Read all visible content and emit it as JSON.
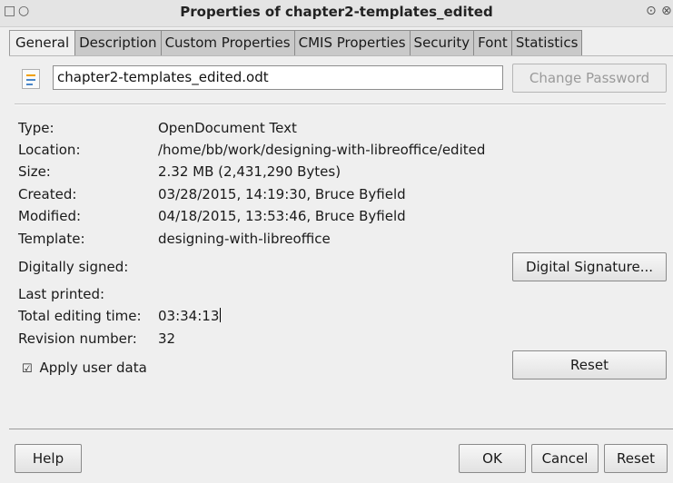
{
  "window": {
    "title": "Properties of chapter2-templates_edited"
  },
  "tabs": [
    {
      "label": "General",
      "active": true
    },
    {
      "label": "Description"
    },
    {
      "label": "Custom Properties"
    },
    {
      "label": "CMIS Properties"
    },
    {
      "label": "Security"
    },
    {
      "label": "Font"
    },
    {
      "label": "Statistics"
    }
  ],
  "general": {
    "file_name": "chapter2-templates_edited.odt",
    "change_password_label": "Change Password",
    "fields": [
      {
        "label": "Type:",
        "value": "OpenDocument Text"
      },
      {
        "label": "Location:",
        "value": "/home/bb/work/designing-with-libreoffice/edited"
      },
      {
        "label": "Size:",
        "value": "2.32 MB (2,431,290 Bytes)"
      },
      {
        "label": "Created:",
        "value": "03/28/2015, 14:19:30, Bruce Byfield"
      },
      {
        "label": "Modified:",
        "value": "04/18/2015, 13:53:46, Bruce Byfield"
      },
      {
        "label": "Template:",
        "value": "designing-with-libreoffice"
      }
    ],
    "digitally_signed_label": "Digitally signed:",
    "digital_signature_button": "Digital Signature...",
    "last_printed_label": "Last printed:",
    "last_printed_value": "",
    "total_editing_time_label": "Total editing time:",
    "total_editing_time_value": "03:34:13",
    "revision_number_label": "Revision number:",
    "revision_number_value": "32",
    "apply_user_data_label": "Apply user data",
    "apply_user_data_checked": true,
    "reset_label": "Reset"
  },
  "footer": {
    "help_label": "Help",
    "ok_label": "OK",
    "cancel_label": "Cancel",
    "reset_label": "Reset"
  }
}
